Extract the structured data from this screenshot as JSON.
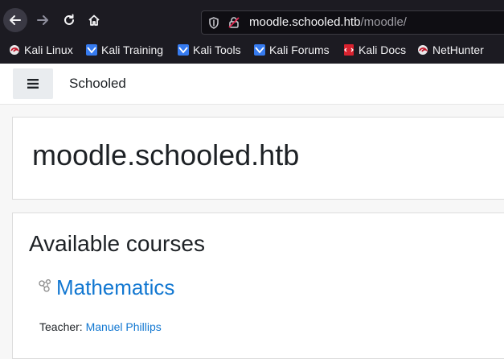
{
  "browser": {
    "url_host": "moodle.schooled.htb",
    "url_path": "/moodle/",
    "bookmarks": [
      {
        "label": "Kali Linux",
        "icon": "kali-dragon-icon"
      },
      {
        "label": "Kali Training",
        "icon": "kali-training-icon"
      },
      {
        "label": "Kali Tools",
        "icon": "kali-tools-icon"
      },
      {
        "label": "Kali Forums",
        "icon": "kali-forums-icon"
      },
      {
        "label": "Kali Docs",
        "icon": "kali-docs-icon"
      },
      {
        "label": "NetHunter",
        "icon": "nethunter-icon"
      }
    ]
  },
  "navbar": {
    "site_name": "Schooled"
  },
  "page": {
    "heading": "moodle.schooled.htb"
  },
  "courses": {
    "heading": "Available courses",
    "items": [
      {
        "name": "Mathematics",
        "teacher_label": "Teacher:",
        "teacher_name": "Manuel Phillips"
      }
    ]
  }
}
